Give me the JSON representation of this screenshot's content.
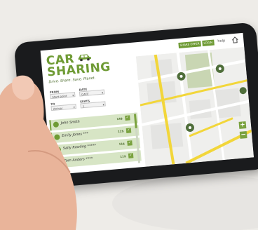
{
  "app": {
    "logo_line1": "CAR",
    "logo_line2": "SHARING",
    "tagline": "Drive. Share. Save. Planet."
  },
  "header": {
    "btn_share": "SHARE OFFER",
    "btn_login": "LOGIN",
    "btn_help": "help",
    "home_icon": "home-icon"
  },
  "form": {
    "from_label": "FROM",
    "from_value": "Start point",
    "to_label": "TO",
    "to_value": "Arrival",
    "date_label": "DATE",
    "date_value": "DATE",
    "seats_label": "SEATS",
    "seats_value": "1"
  },
  "list": [
    {
      "name": "John Smith",
      "price": "14$"
    },
    {
      "name": "Emily Jones ***",
      "price": "12$"
    },
    {
      "name": "Sally Rowling *****",
      "price": "11$"
    },
    {
      "name": "Tom Anders ****",
      "price": "11$"
    }
  ],
  "map": {
    "zoom_in": "+",
    "zoom_out": "−"
  },
  "colors": {
    "brand_green": "#6f9b35",
    "road_yellow": "#f2d63a",
    "map_bg": "#eeeeec"
  }
}
